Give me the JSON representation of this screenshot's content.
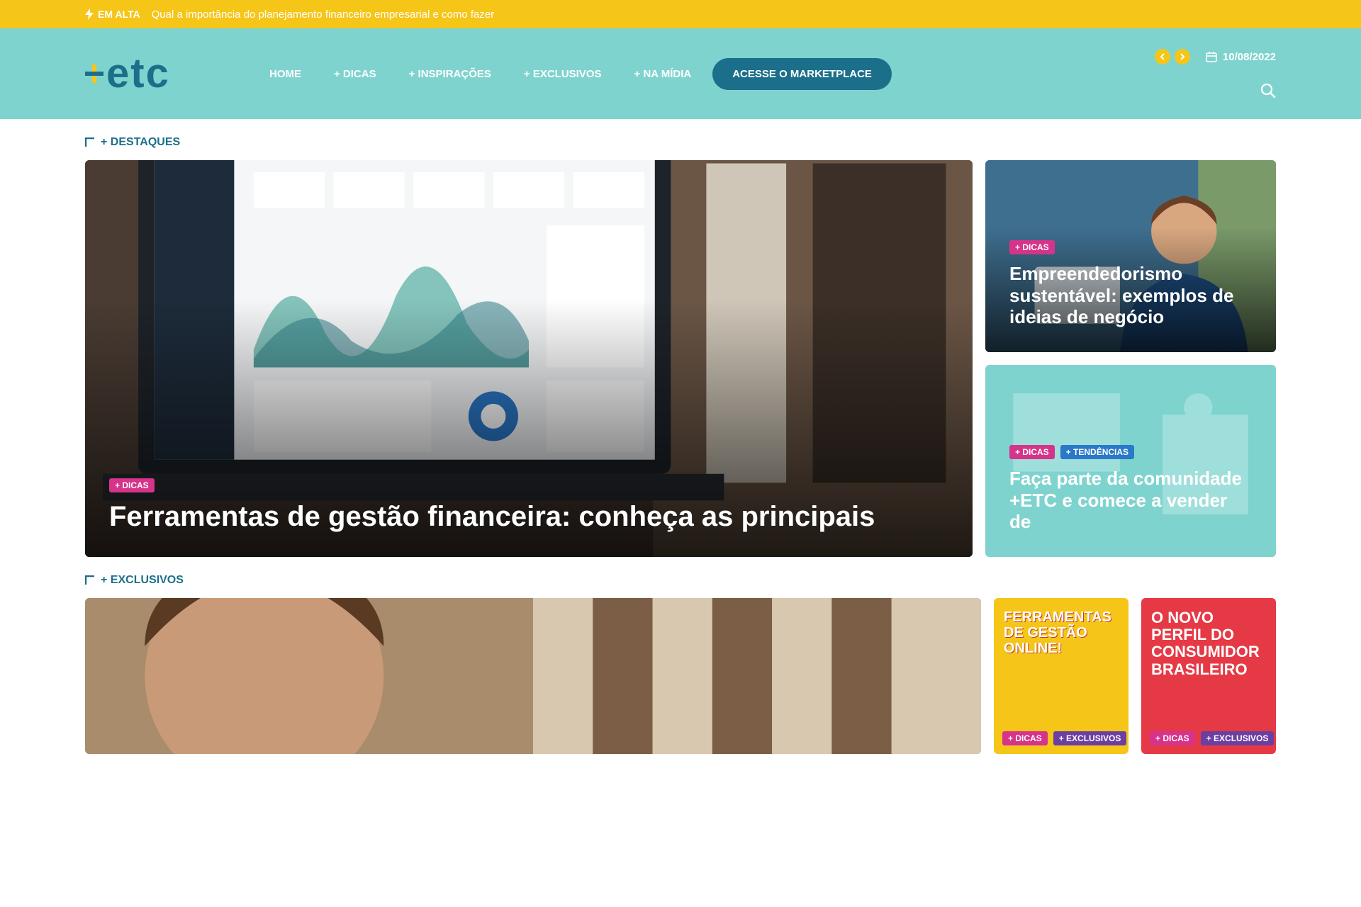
{
  "ticker": {
    "badge": "EM ALTA",
    "headline": "Qual a importância do planejamento financeiro empresarial e como fazer"
  },
  "header": {
    "logo_text": "etc",
    "nav": [
      "HOME",
      "+ DICAS",
      "+ INSPIRAÇÕES",
      "+ EXCLUSIVOS",
      "+ NA MÍDIA"
    ],
    "cta": "ACESSE O MARKETPLACE",
    "date": "10/08/2022"
  },
  "destaques": {
    "title": "+ DESTAQUES",
    "main": {
      "tags": [
        "+ DICAS"
      ],
      "title": "Ferramentas de gestão financeira: conheça as principais"
    },
    "side": [
      {
        "tags": [
          "+ DICAS"
        ],
        "title": "Empreendedorismo sustentável: exemplos de ideias de negócio"
      },
      {
        "tags": [
          "+ DICAS",
          "+ TENDÊNCIAS"
        ],
        "title": "Faça parte da comunidade +ETC e comece a vender de"
      }
    ]
  },
  "exclusivos": {
    "title": "+ EXCLUSIVOS",
    "items": [
      {
        "tags": []
      },
      {
        "cover_title": "FERRAMENTAS DE GESTÃO ONLINE!",
        "tags": [
          "+ DICAS",
          "+ EXCLUSIVOS"
        ]
      },
      {
        "cover_title": "O NOVO PERFIL DO CONSUMIDOR BRASILEIRO",
        "tags": [
          "+ DICAS",
          "+ EXCLUSIVOS"
        ]
      }
    ]
  },
  "colors": {
    "ticker": "#f5c518",
    "header": "#7fd3cf",
    "brand": "#1b6f8a",
    "tag_pink": "#d6338a",
    "tag_blue": "#2a78c8",
    "tag_purple": "#6b3fa0"
  },
  "icons": [
    "lightning-icon",
    "plus-icon",
    "chevron-left-icon",
    "chevron-right-icon",
    "calendar-icon",
    "search-icon",
    "corner-bracket-icon"
  ]
}
